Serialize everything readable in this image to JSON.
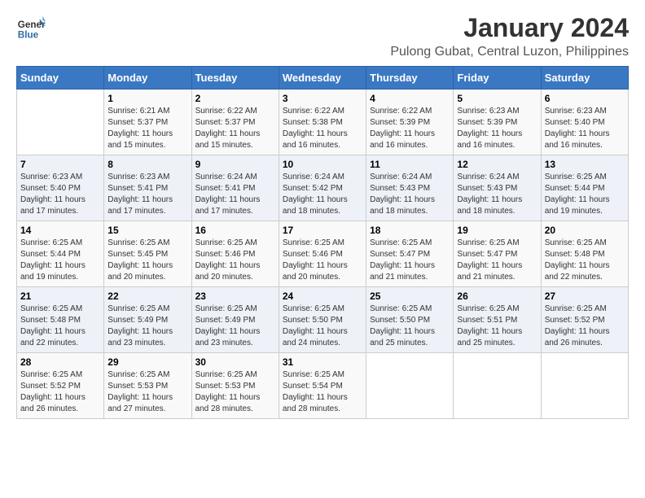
{
  "header": {
    "logo_line1": "General",
    "logo_line2": "Blue",
    "title": "January 2024",
    "subtitle": "Pulong Gubat, Central Luzon, Philippines"
  },
  "calendar": {
    "weekdays": [
      "Sunday",
      "Monday",
      "Tuesday",
      "Wednesday",
      "Thursday",
      "Friday",
      "Saturday"
    ],
    "weeks": [
      [
        {
          "day": "",
          "info": ""
        },
        {
          "day": "1",
          "info": "Sunrise: 6:21 AM\nSunset: 5:37 PM\nDaylight: 11 hours\nand 15 minutes."
        },
        {
          "day": "2",
          "info": "Sunrise: 6:22 AM\nSunset: 5:37 PM\nDaylight: 11 hours\nand 15 minutes."
        },
        {
          "day": "3",
          "info": "Sunrise: 6:22 AM\nSunset: 5:38 PM\nDaylight: 11 hours\nand 16 minutes."
        },
        {
          "day": "4",
          "info": "Sunrise: 6:22 AM\nSunset: 5:39 PM\nDaylight: 11 hours\nand 16 minutes."
        },
        {
          "day": "5",
          "info": "Sunrise: 6:23 AM\nSunset: 5:39 PM\nDaylight: 11 hours\nand 16 minutes."
        },
        {
          "day": "6",
          "info": "Sunrise: 6:23 AM\nSunset: 5:40 PM\nDaylight: 11 hours\nand 16 minutes."
        }
      ],
      [
        {
          "day": "7",
          "info": "Sunrise: 6:23 AM\nSunset: 5:40 PM\nDaylight: 11 hours\nand 17 minutes."
        },
        {
          "day": "8",
          "info": "Sunrise: 6:23 AM\nSunset: 5:41 PM\nDaylight: 11 hours\nand 17 minutes."
        },
        {
          "day": "9",
          "info": "Sunrise: 6:24 AM\nSunset: 5:41 PM\nDaylight: 11 hours\nand 17 minutes."
        },
        {
          "day": "10",
          "info": "Sunrise: 6:24 AM\nSunset: 5:42 PM\nDaylight: 11 hours\nand 18 minutes."
        },
        {
          "day": "11",
          "info": "Sunrise: 6:24 AM\nSunset: 5:43 PM\nDaylight: 11 hours\nand 18 minutes."
        },
        {
          "day": "12",
          "info": "Sunrise: 6:24 AM\nSunset: 5:43 PM\nDaylight: 11 hours\nand 18 minutes."
        },
        {
          "day": "13",
          "info": "Sunrise: 6:25 AM\nSunset: 5:44 PM\nDaylight: 11 hours\nand 19 minutes."
        }
      ],
      [
        {
          "day": "14",
          "info": "Sunrise: 6:25 AM\nSunset: 5:44 PM\nDaylight: 11 hours\nand 19 minutes."
        },
        {
          "day": "15",
          "info": "Sunrise: 6:25 AM\nSunset: 5:45 PM\nDaylight: 11 hours\nand 20 minutes."
        },
        {
          "day": "16",
          "info": "Sunrise: 6:25 AM\nSunset: 5:46 PM\nDaylight: 11 hours\nand 20 minutes."
        },
        {
          "day": "17",
          "info": "Sunrise: 6:25 AM\nSunset: 5:46 PM\nDaylight: 11 hours\nand 20 minutes."
        },
        {
          "day": "18",
          "info": "Sunrise: 6:25 AM\nSunset: 5:47 PM\nDaylight: 11 hours\nand 21 minutes."
        },
        {
          "day": "19",
          "info": "Sunrise: 6:25 AM\nSunset: 5:47 PM\nDaylight: 11 hours\nand 21 minutes."
        },
        {
          "day": "20",
          "info": "Sunrise: 6:25 AM\nSunset: 5:48 PM\nDaylight: 11 hours\nand 22 minutes."
        }
      ],
      [
        {
          "day": "21",
          "info": "Sunrise: 6:25 AM\nSunset: 5:48 PM\nDaylight: 11 hours\nand 22 minutes."
        },
        {
          "day": "22",
          "info": "Sunrise: 6:25 AM\nSunset: 5:49 PM\nDaylight: 11 hours\nand 23 minutes."
        },
        {
          "day": "23",
          "info": "Sunrise: 6:25 AM\nSunset: 5:49 PM\nDaylight: 11 hours\nand 23 minutes."
        },
        {
          "day": "24",
          "info": "Sunrise: 6:25 AM\nSunset: 5:50 PM\nDaylight: 11 hours\nand 24 minutes."
        },
        {
          "day": "25",
          "info": "Sunrise: 6:25 AM\nSunset: 5:50 PM\nDaylight: 11 hours\nand 25 minutes."
        },
        {
          "day": "26",
          "info": "Sunrise: 6:25 AM\nSunset: 5:51 PM\nDaylight: 11 hours\nand 25 minutes."
        },
        {
          "day": "27",
          "info": "Sunrise: 6:25 AM\nSunset: 5:52 PM\nDaylight: 11 hours\nand 26 minutes."
        }
      ],
      [
        {
          "day": "28",
          "info": "Sunrise: 6:25 AM\nSunset: 5:52 PM\nDaylight: 11 hours\nand 26 minutes."
        },
        {
          "day": "29",
          "info": "Sunrise: 6:25 AM\nSunset: 5:53 PM\nDaylight: 11 hours\nand 27 minutes."
        },
        {
          "day": "30",
          "info": "Sunrise: 6:25 AM\nSunset: 5:53 PM\nDaylight: 11 hours\nand 28 minutes."
        },
        {
          "day": "31",
          "info": "Sunrise: 6:25 AM\nSunset: 5:54 PM\nDaylight: 11 hours\nand 28 minutes."
        },
        {
          "day": "",
          "info": ""
        },
        {
          "day": "",
          "info": ""
        },
        {
          "day": "",
          "info": ""
        }
      ]
    ]
  }
}
